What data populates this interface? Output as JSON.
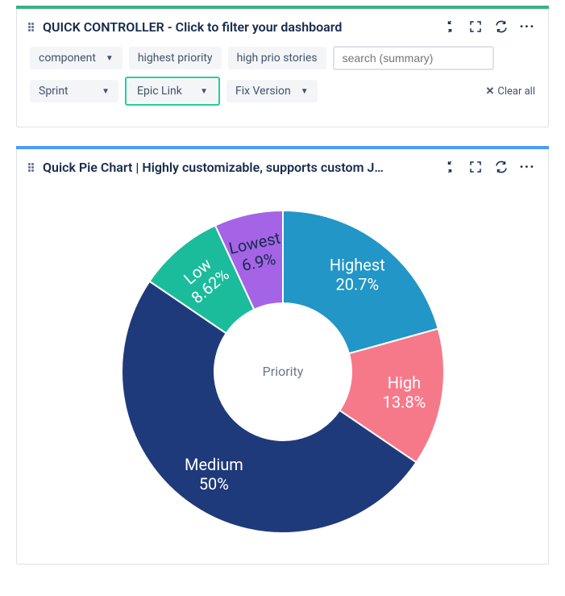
{
  "panel1": {
    "title": "QUICK CONTROLLER - Click to filter your dashboard",
    "dropdown_component": "component",
    "chip_highest": "highest priority",
    "chip_highprio": "high prio stories",
    "search_placeholder": "search (summary)",
    "dropdown_sprint": "Sprint",
    "dropdown_epic": "Epic Link",
    "dropdown_fix": "Fix Version",
    "clear_all": "Clear all"
  },
  "panel2": {
    "title": "Quick Pie Chart | Highly customizable, supports custom J…",
    "center_label": "Priority"
  },
  "chart_data": {
    "type": "pie",
    "title": "Priority",
    "series": [
      {
        "name": "Highest",
        "value": 20.7,
        "label": "20.7%",
        "color": "#2196c7"
      },
      {
        "name": "High",
        "value": 13.8,
        "label": "13.8%",
        "color": "#f6798a"
      },
      {
        "name": "Medium",
        "value": 50.0,
        "label": "50%",
        "color": "#1f3a7a"
      },
      {
        "name": "Low",
        "value": 8.62,
        "label": "8.62%",
        "color": "#1abc9c"
      },
      {
        "name": "Lowest",
        "value": 6.9,
        "label": "6.9%",
        "color": "#a564e6"
      }
    ]
  }
}
